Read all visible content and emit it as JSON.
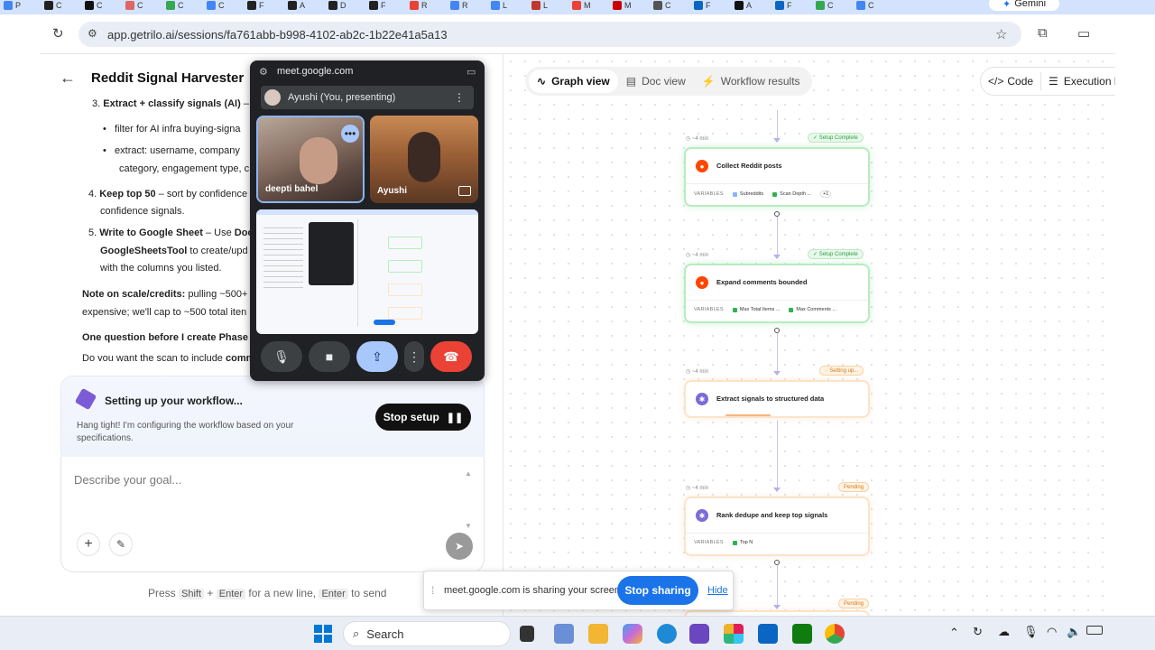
{
  "browser": {
    "tabs": [
      "P",
      "C",
      "C",
      "C",
      "C",
      "C",
      "F",
      "A",
      "D",
      "F",
      "R",
      "R",
      "L",
      "L",
      "M",
      "M",
      "C",
      "F",
      "A",
      "F",
      "C",
      "C"
    ],
    "gemini_label": "Gemini",
    "url": "app.getrilo.ai/sessions/fa761abb-b998-4102-ab2c-1b22e41a5a13"
  },
  "app": {
    "page_title": "Reddit Signal Harvester",
    "doc": {
      "step3_title": "Extract + classify signals (AI)",
      "step3_suffix": " – U",
      "step3_bullet1": "filter for AI infra buying-signa",
      "step3_bullet2a": "extract: username, company",
      "step3_bullet2b": "category, engagement type, c",
      "step4_title": "Keep top 50",
      "step4_text": " – sort by confidence",
      "step4_cont": "confidence signals.",
      "step5_title": "Write to Google Sheet",
      "step5_text": " – Use ",
      "step5_bold": "Doc",
      "step5_tool": "GoogleSheetsTool",
      "step5_text2": " to create/upd",
      "step5_cont": "with the columns you listed.",
      "note_title": "Note on scale/credits:",
      "note_text": " pulling ~500+",
      "note_cont": "expensive; we'll cap to ~500 total iten",
      "question": "One question before I create Phase",
      "question2_a": "Do you want the scan to include ",
      "question2_b": "comm"
    },
    "setup": {
      "title": "Setting up your workflow...",
      "desc": "Hang tight! I'm configuring the workflow based on your specifications.",
      "stop_label": "Stop setup"
    },
    "composer": {
      "placeholder": "Describe your goal..."
    },
    "hint": {
      "press": "Press",
      "shift": "Shift",
      "plus": "+",
      "enter": "Enter",
      "for_new_line": "for a new line,",
      "enter2": "Enter",
      "to_send": "to send"
    },
    "view_tabs": [
      "Graph view",
      "Doc view",
      "Workflow results"
    ],
    "code_label": "Code",
    "execution_label": "Execution h",
    "nodes": [
      {
        "time": "~4 min",
        "status": "Setup Complete",
        "title": "Collect Reddit posts",
        "variables_label": "VARIABLES",
        "vars": [
          "Subreddits",
          "Scan Depth ..."
        ],
        "extra": "+1"
      },
      {
        "time": "~4 min",
        "status": "Setup Complete",
        "title": "Expand comments bounded",
        "variables_label": "VARIABLES",
        "vars": [
          "Max Total Items ...",
          "Max Comments ..."
        ]
      },
      {
        "time": "~4 min",
        "status": "Setting up...",
        "title": "Extract signals to structured data"
      },
      {
        "time": "~4 min",
        "status": "Pending",
        "title": "Rank dedupe and keep top signals",
        "variables_label": "VARIABLES",
        "vars": [
          "Top N"
        ]
      },
      {
        "status": "Pending"
      }
    ]
  },
  "meet": {
    "url": "meet.google.com",
    "presenting": "Ayushi (You, presenting)",
    "participants": [
      "deepti bahel",
      "Ayushi"
    ]
  },
  "sharebar": {
    "text": "meet.google.com is sharing your screen.",
    "stop": "Stop sharing",
    "hide": "Hide"
  },
  "taskbar": {
    "search": "Search"
  },
  "colors": {
    "accent_green": "#2fb34e",
    "accent_orange": "#d27a16",
    "meet_red": "#ea4335",
    "meet_blue": "#1a73e8"
  }
}
